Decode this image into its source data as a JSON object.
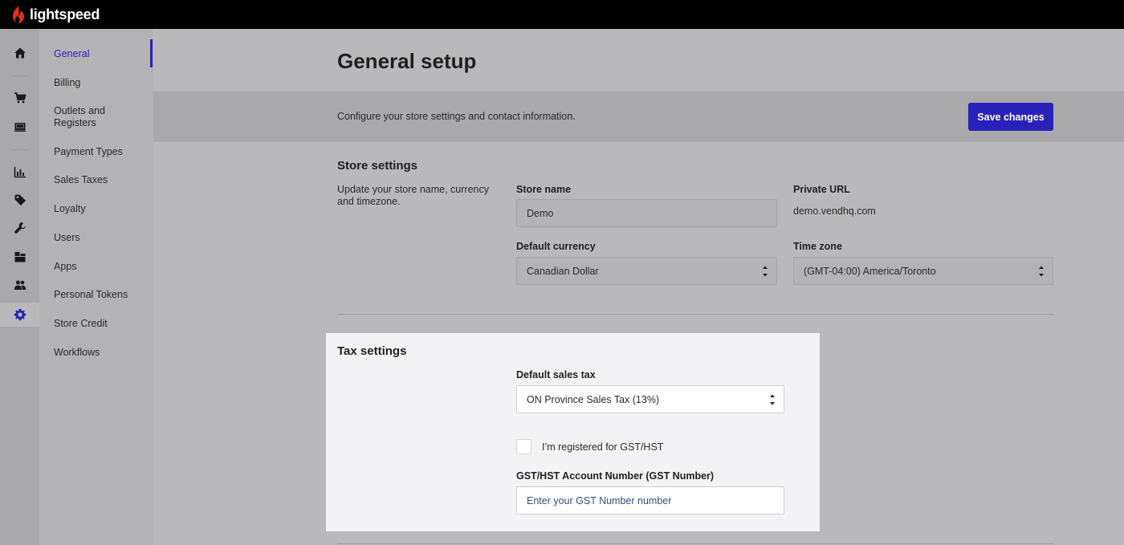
{
  "brand": {
    "name": "lightspeed",
    "color": "#e0301e"
  },
  "iconrail": [
    {
      "icon": "home-icon"
    },
    {
      "icon": "cart-icon"
    },
    {
      "icon": "register-icon"
    },
    {
      "icon": "chart-icon"
    },
    {
      "icon": "tag-icon"
    },
    {
      "icon": "wrench-icon"
    },
    {
      "icon": "inventory-icon"
    },
    {
      "icon": "customers-icon"
    },
    {
      "icon": "gear-icon",
      "active": true
    }
  ],
  "subnav": {
    "items": [
      {
        "label": "General",
        "active": true
      },
      {
        "label": "Billing"
      },
      {
        "label": "Outlets and Registers"
      },
      {
        "label": "Payment Types"
      },
      {
        "label": "Sales Taxes"
      },
      {
        "label": "Loyalty"
      },
      {
        "label": "Users"
      },
      {
        "label": "Apps"
      },
      {
        "label": "Personal Tokens"
      },
      {
        "label": "Store Credit"
      },
      {
        "label": "Workflows"
      }
    ]
  },
  "page": {
    "title": "General setup",
    "description": "Configure your store settings and contact information.",
    "save_label": "Save changes"
  },
  "store_settings": {
    "title": "Store settings",
    "description": "Update your store name, currency and timezone.",
    "store_name_label": "Store name",
    "store_name_value": "Demo",
    "private_url_label": "Private URL",
    "private_url_value": "demo.vendhq.com",
    "currency_label": "Default currency",
    "currency_value": "Canadian Dollar",
    "timezone_label": "Time zone",
    "timezone_value": "(GMT-04:00) America/Toronto"
  },
  "tax_settings": {
    "title": "Tax settings",
    "default_tax_label": "Default sales tax",
    "default_tax_value": "ON Province Sales Tax (13%)",
    "gst_checkbox_label": "I’m registered for GST/HST",
    "gst_checked": false,
    "gst_number_label": "GST/HST Account Number (GST Number)",
    "gst_number_value": "",
    "gst_number_placeholder": "Enter your GST Number number"
  },
  "colors": {
    "accent": "#2a22b8",
    "topbar": "#000000"
  }
}
